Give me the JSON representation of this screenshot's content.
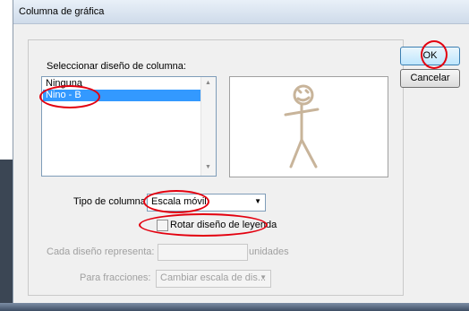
{
  "window": {
    "title": "Columna de gráfica"
  },
  "design": {
    "label": "Seleccionar diseño de columna:",
    "items": [
      "Ninguna",
      "Nino - B"
    ],
    "selected_index": 1
  },
  "column_type": {
    "label": "Tipo de columna:",
    "value": "Escala móvil"
  },
  "rotate_legend": {
    "label": "Rotar diseño de leyenda",
    "checked": false
  },
  "each_design": {
    "label": "Cada diseño representa:",
    "value": "",
    "unit": "unidades"
  },
  "fractions": {
    "label": "Para fracciones:",
    "value": "Cambiar escala de dis..."
  },
  "buttons": {
    "ok": "OK",
    "cancel": "Cancelar"
  },
  "colors": {
    "highlight": "#e3000f",
    "selection": "#3399ff",
    "figure": "#c8b49a"
  },
  "icons": [
    "dropdown-arrow-icon",
    "scroll-up-icon",
    "scroll-down-icon"
  ]
}
